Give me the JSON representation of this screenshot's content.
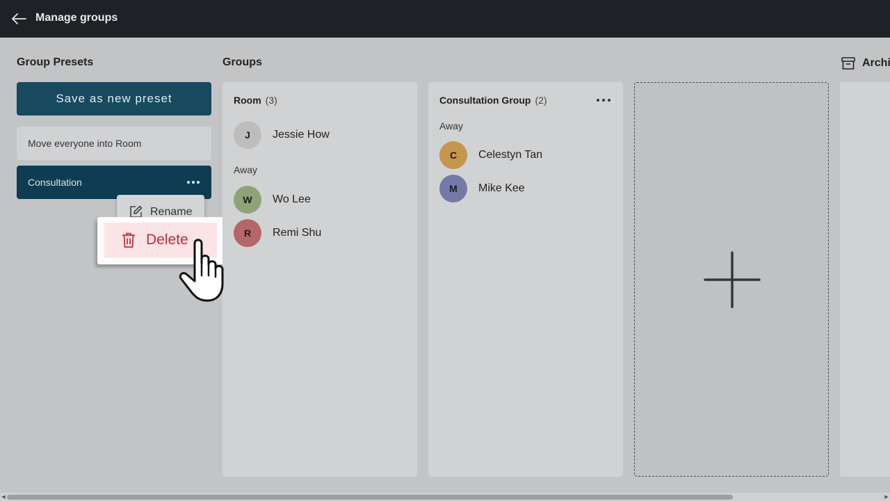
{
  "header": {
    "title": "Manage groups",
    "back_icon": "arrow-left-icon"
  },
  "presets": {
    "title": "Group Presets",
    "save_label": "Save as new preset",
    "items": [
      {
        "label": "Move everyone into Room"
      },
      {
        "label": "Consultation"
      }
    ],
    "context_menu": {
      "rename_label": "Rename",
      "delete_label": "Delete"
    }
  },
  "groups": {
    "title": "Groups",
    "columns": [
      {
        "name": "Room",
        "count": "(3)",
        "members": [
          {
            "initial": "J",
            "name": "Jessie How"
          }
        ],
        "away_label": "Away",
        "away_members": [
          {
            "initial": "W",
            "name": "Wo Lee"
          },
          {
            "initial": "R",
            "name": "Remi Shu"
          }
        ]
      },
      {
        "name": "Consultation Group",
        "count": "(2)",
        "away_label": "Away",
        "away_members": [
          {
            "initial": "C",
            "name": "Celestyn Tan"
          },
          {
            "initial": "M",
            "name": "Mike Kee"
          }
        ]
      }
    ]
  },
  "archive": {
    "label": "Archi"
  },
  "colors": {
    "topbar": "#1e2126",
    "primary": "#17495f",
    "preset_selected": "#0e3c52",
    "danger": "#c5283a",
    "avatar_j": "#bdbdbe",
    "avatar_w": "#8fa476",
    "avatar_r": "#b56666",
    "avatar_c": "#c6954e",
    "avatar_m": "#7479a8"
  }
}
